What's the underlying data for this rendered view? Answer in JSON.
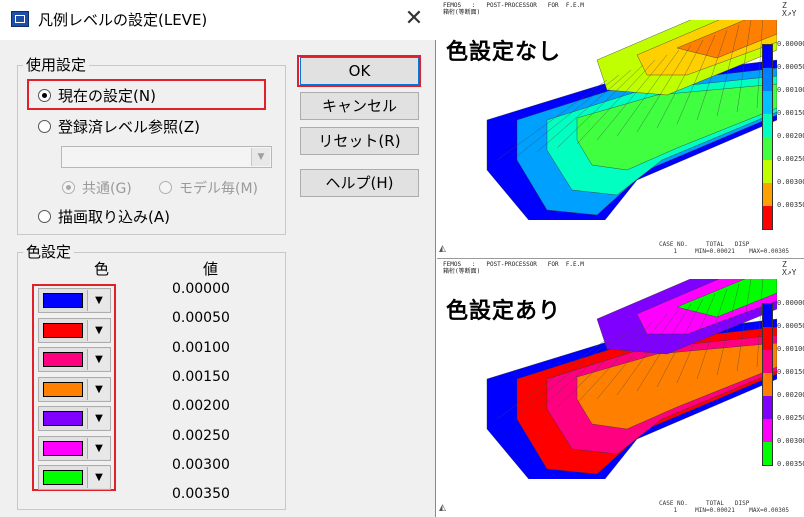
{
  "dialog": {
    "title": "凡例レベルの設定(LEVE)",
    "close_glyph": "✕",
    "usage_group_label": "使用設定",
    "radio_current": "現在の設定(N)",
    "radio_registered": "登録済レベル参照(Z)",
    "radio_common": "共通(G)",
    "radio_per_model": "モデル毎(M)",
    "radio_import": "描画取り込み(A)",
    "combo_value": "",
    "combo_arrow": "▼",
    "buttons": {
      "ok": "OK",
      "cancel": "キャンセル",
      "reset": "リセット(R)",
      "help": "ヘルプ(H)"
    },
    "color_group_label": "色設定",
    "col_color": "色",
    "col_value": "値",
    "dropdown_glyph": "▼",
    "colors": [
      {
        "hex": "#0000ff",
        "name": "blue"
      },
      {
        "hex": "#ff0000",
        "name": "red"
      },
      {
        "hex": "#ff0080",
        "name": "pink"
      },
      {
        "hex": "#ff8000",
        "name": "orange"
      },
      {
        "hex": "#8000ff",
        "name": "purple"
      },
      {
        "hex": "#ff00ff",
        "name": "magenta"
      },
      {
        "hex": "#00ff00",
        "name": "green"
      }
    ],
    "values": [
      "0.00000",
      "0.00050",
      "0.00100",
      "0.00150",
      "0.00200",
      "0.00250",
      "0.00300",
      "0.00350"
    ],
    "highlight_color": "#e0202a"
  },
  "viewers": [
    {
      "header": "FEMOS   :   POST-PROCESSOR   FOR  F.E.M\n箱桁(等断面)",
      "label": "色設定なし",
      "axis": "Z\nX↗Y",
      "legend_colors": [
        "#0000ff",
        "#0080ff",
        "#00c0ff",
        "#00ffc0",
        "#40ff40",
        "#c0ff00",
        "#ffa000",
        "#ff0000"
      ],
      "legend_values": [
        "0.00000",
        "0.00050",
        "0.00100",
        "0.00150",
        "0.00200",
        "0.00250",
        "0.00300",
        "0.00350"
      ],
      "footer": "CASE NO.     TOTAL   DISP\n    1     MIN=0.00021    MAX=0.00305",
      "plot_colors": [
        "#0000ff",
        "#00a0ff",
        "#00ffc0",
        "#40ff40",
        "#c0ff00",
        "#ffd000",
        "#ff8000"
      ]
    },
    {
      "header": "FEMOS   :   POST-PROCESSOR   FOR  F.E.M\n箱桁(等断面)",
      "label": "色設定あり",
      "axis": "Z\nX↗Y",
      "legend_colors": [
        "#0000ff",
        "#ff0000",
        "#ff0080",
        "#ff8000",
        "#8000ff",
        "#ff00ff",
        "#00ff00"
      ],
      "legend_values": [
        "0.00000",
        "0.00050",
        "0.00100",
        "0.00150",
        "0.00200",
        "0.00250",
        "0.00300",
        "0.00350"
      ],
      "footer": "CASE NO.     TOTAL   DISP\n    1     MIN=0.00021    MAX=0.00305",
      "plot_colors": [
        "#0000ff",
        "#ff0000",
        "#ff0080",
        "#ff8000",
        "#8000ff",
        "#ff00ff",
        "#00ff00"
      ]
    }
  ]
}
